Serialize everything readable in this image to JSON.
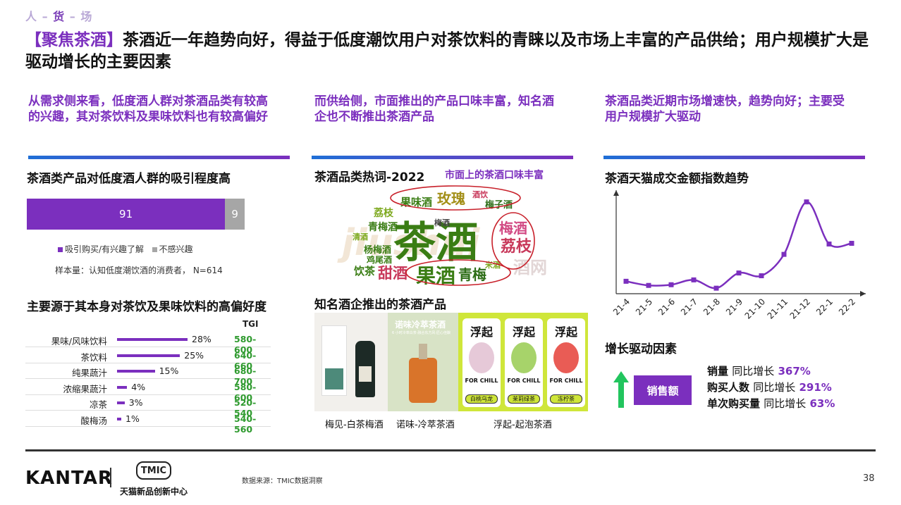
{
  "breadcrumb": {
    "a": "人",
    "sep1": "–",
    "b": "货",
    "sep2": "–",
    "c": "场"
  },
  "title": {
    "tag": "【聚焦茶酒】",
    "text": "茶酒近一年趋势向好，得益于低度潮饮用户对茶饮料的青睐以及市场上丰富的产品供给；用户规模扩大是驱动增长的主要因素"
  },
  "columns": {
    "left_intro": "从需求侧来看，低度酒人群对茶酒品类有较高的兴趣，其对茶饮料及果味饮料也有较高偏好",
    "mid_intro": "而供给侧，市面推出的产品口味丰富，知名酒企也不断推出茶酒产品",
    "right_intro": "茶酒品类近期市场增速快，趋势向好；主要受用户规模扩大驱动"
  },
  "attraction": {
    "heading": "茶酒类产品对低度酒人群的吸引程度高",
    "interested": 91,
    "not_interested": 9,
    "interested_label": "吸引购买/有兴趣了解",
    "not_label": "不感兴趣",
    "sample": "样本量：认知低度潮饮酒的消费者，  N=614",
    "colors": {
      "interested": "#7b2fbe",
      "not": "#a6a6a6"
    }
  },
  "preference": {
    "heading": "主要源于其本身对茶饮及果味饮料的高偏好度",
    "tgi_header": "TGI",
    "rows": [
      {
        "label": "果味/风味饮料",
        "pct": "28%",
        "value": 28,
        "tgi": "580-600"
      },
      {
        "label": "茶饮料",
        "pct": "25%",
        "value": 25,
        "tgi": "640-660"
      },
      {
        "label": "纯果蔬汁",
        "pct": "15%",
        "value": 15,
        "tgi": "680-700"
      },
      {
        "label": "浓缩果蔬汁",
        "pct": "4%",
        "value": 4,
        "tgi": "580-600"
      },
      {
        "label": "凉茶",
        "pct": "3%",
        "value": 3,
        "tgi": "520-540"
      },
      {
        "label": "酸梅汤",
        "pct": "1%",
        "value": 1,
        "tgi": "540-560"
      }
    ]
  },
  "wordcloud": {
    "heading": "茶酒品类热词-2022",
    "note": "市面上的茶酒口味丰富",
    "words": {
      "main": "茶酒",
      "meigui": "玫瑰",
      "guowei": "果味酒",
      "meizi": "梅子酒",
      "jiuyi": "酒饮",
      "lizhi": "荔枝",
      "lizhi2": "荔枝",
      "qingmei": "青梅酒",
      "meijiu": "梅酒",
      "meijiu2": "梅酒",
      "yangmei": "杨梅酒",
      "jiwei": "鸡尾酒",
      "yincha": "饮茶",
      "tianjiu": "甜酒",
      "guojiu": "果酒",
      "qingmei2": "青梅",
      "qingjiu": "清酒",
      "mijiu": "米酒",
      "wm": "酒网",
      "ph": "jiushui"
    }
  },
  "products": {
    "heading": "知名酒企推出的茶酒产品",
    "items": [
      {
        "caption": "梅见-白茶梅酒"
      },
      {
        "caption": "诺味-冷萃茶酒",
        "label": "诺味冷萃茶酒",
        "small": "6 小时冷萃白茶·融合东方风·匠心佳酿"
      },
      {
        "caption": "浮起-起泡茶酒",
        "cans": [
          "浮起",
          "浮起",
          "浮起"
        ],
        "can_text": "FOR CHILL",
        "flavors": [
          "白桃乌龙",
          "茉莉绿茶",
          "冻柠茶"
        ]
      }
    ]
  },
  "trend": {
    "heading": "茶酒天猫成交金额指数趋势"
  },
  "chart_data": {
    "type": "line",
    "title": "茶酒天猫成交金额指数趋势",
    "categories": [
      "21-4",
      "21-5",
      "21-6",
      "21-7",
      "21-8",
      "21-9",
      "21-10",
      "21-11",
      "21-12",
      "22-1",
      "22-2"
    ],
    "values": [
      18,
      12,
      13,
      20,
      8,
      30,
      26,
      57,
      133,
      72,
      73
    ],
    "ylim": [
      0,
      150
    ],
    "color": "#7b2fbe",
    "grid": false
  },
  "drivers": {
    "heading": "增长驱动因素",
    "badge": "销售额",
    "lines": [
      {
        "label": "销量",
        "mid": "同比增长",
        "value": "367%"
      },
      {
        "label": "购买人数",
        "mid": "同比增长",
        "value": "291%"
      },
      {
        "label": "单次购买量",
        "mid": "同比增长",
        "value": "63%"
      }
    ]
  },
  "footer": {
    "brand": "KANTAR",
    "tmic_logo": "TMIC",
    "tmic_name": "天猫新品创新中心",
    "source": "数据来源：TMIC数据洞察",
    "page": "38"
  }
}
